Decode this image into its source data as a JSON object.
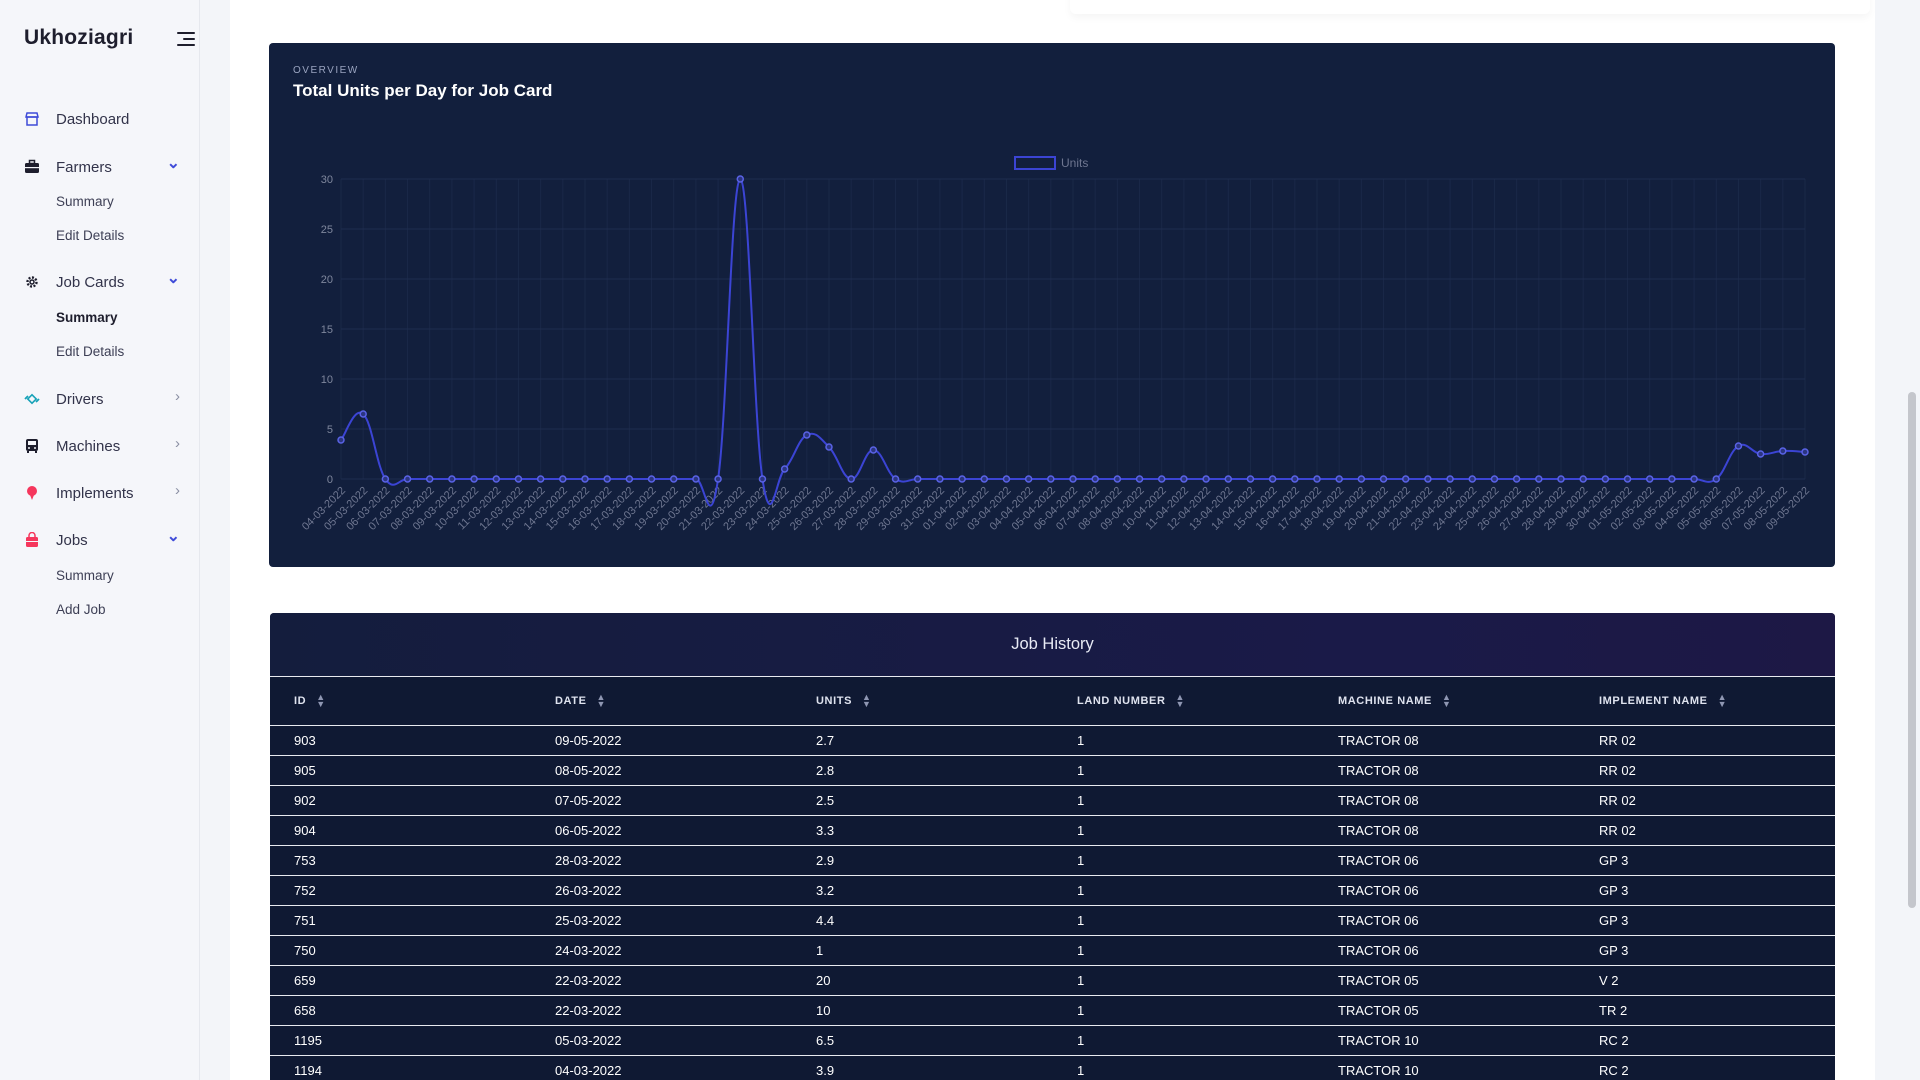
{
  "sidebar": {
    "brand": "Ukhoziagri",
    "items": [
      {
        "label": "Dashboard",
        "icon": "store-icon",
        "color": "#3f4bd8"
      },
      {
        "label": "Farmers",
        "icon": "briefcase-icon",
        "color": "#1e1e2d",
        "expanded": true,
        "children": [
          {
            "label": "Summary"
          },
          {
            "label": "Edit Details"
          }
        ]
      },
      {
        "label": "Job Cards",
        "icon": "gear-icon",
        "color": "#1e1e2d",
        "expanded": true,
        "children": [
          {
            "label": "Summary",
            "active": true
          },
          {
            "label": "Edit Details"
          }
        ]
      },
      {
        "label": "Drivers",
        "icon": "satellite-icon",
        "color": "#17a2b8"
      },
      {
        "label": "Machines",
        "icon": "bus-icon",
        "color": "#1e1e2d"
      },
      {
        "label": "Implements",
        "icon": "pin-icon",
        "color": "#f5365c"
      },
      {
        "label": "Jobs",
        "icon": "shopping-bag-icon",
        "color": "#f5365c",
        "expanded": true,
        "children": [
          {
            "label": "Summary"
          },
          {
            "label": "Add Job"
          }
        ]
      }
    ]
  },
  "chart_card": {
    "overline": "OVERVIEW",
    "title": "Total Units per Day for Job Card"
  },
  "chart_data": {
    "type": "line",
    "title": "Total Units per Day for Job Card",
    "legend": [
      "Units"
    ],
    "legend_position": "top-center",
    "ylim": [
      0,
      30
    ],
    "yticks": [
      0,
      5,
      10,
      15,
      20,
      25,
      30
    ],
    "grid": true,
    "line_color": "#3b44d4",
    "x": [
      "04-03-2022",
      "05-03-2022",
      "06-03-2022",
      "07-03-2022",
      "08-03-2022",
      "09-03-2022",
      "10-03-2022",
      "11-03-2022",
      "12-03-2022",
      "13-03-2022",
      "14-03-2022",
      "15-03-2022",
      "16-03-2022",
      "17-03-2022",
      "18-03-2022",
      "19-03-2022",
      "20-03-2022",
      "21-03-2022",
      "22-03-2022",
      "23-03-2022",
      "24-03-2022",
      "25-03-2022",
      "26-03-2022",
      "27-03-2022",
      "28-03-2022",
      "29-03-2022",
      "30-03-2022",
      "31-03-2022",
      "01-04-2022",
      "02-04-2022",
      "03-04-2022",
      "04-04-2022",
      "05-04-2022",
      "06-04-2022",
      "07-04-2022",
      "08-04-2022",
      "09-04-2022",
      "10-04-2022",
      "11-04-2022",
      "12-04-2022",
      "13-04-2022",
      "14-04-2022",
      "15-04-2022",
      "16-04-2022",
      "17-04-2022",
      "18-04-2022",
      "19-04-2022",
      "20-04-2022",
      "21-04-2022",
      "22-04-2022",
      "23-04-2022",
      "24-04-2022",
      "25-04-2022",
      "26-04-2022",
      "27-04-2022",
      "28-04-2022",
      "29-04-2022",
      "30-04-2022",
      "01-05-2022",
      "02-05-2022",
      "03-05-2022",
      "04-05-2022",
      "05-05-2022",
      "06-05-2022",
      "07-05-2022",
      "08-05-2022",
      "09-05-2022"
    ],
    "series": [
      {
        "name": "Units",
        "values": [
          3.9,
          6.5,
          0,
          0,
          0,
          0,
          0,
          0,
          0,
          0,
          0,
          0,
          0,
          0,
          0,
          0,
          0,
          0,
          30,
          0,
          1,
          4.4,
          3.2,
          0,
          2.9,
          0,
          0,
          0,
          0,
          0,
          0,
          0,
          0,
          0,
          0,
          0,
          0,
          0,
          0,
          0,
          0,
          0,
          0,
          0,
          0,
          0,
          0,
          0,
          0,
          0,
          0,
          0,
          0,
          0,
          0,
          0,
          0,
          0,
          0,
          0,
          0,
          0,
          0,
          3.3,
          2.5,
          2.8,
          2.7
        ]
      }
    ]
  },
  "table": {
    "title": "Job History",
    "columns": [
      "ID",
      "DATE",
      "UNITS",
      "LAND NUMBER",
      "MACHINE NAME",
      "IMPLEMENT NAME"
    ],
    "rows": [
      [
        "903",
        "09-05-2022",
        "2.7",
        "1",
        "TRACTOR 08",
        "RR 02"
      ],
      [
        "905",
        "08-05-2022",
        "2.8",
        "1",
        "TRACTOR 08",
        "RR 02"
      ],
      [
        "902",
        "07-05-2022",
        "2.5",
        "1",
        "TRACTOR 08",
        "RR 02"
      ],
      [
        "904",
        "06-05-2022",
        "3.3",
        "1",
        "TRACTOR 08",
        "RR 02"
      ],
      [
        "753",
        "28-03-2022",
        "2.9",
        "1",
        "TRACTOR 06",
        "GP 3"
      ],
      [
        "752",
        "26-03-2022",
        "3.2",
        "1",
        "TRACTOR 06",
        "GP 3"
      ],
      [
        "751",
        "25-03-2022",
        "4.4",
        "1",
        "TRACTOR 06",
        "GP 3"
      ],
      [
        "750",
        "24-03-2022",
        "1",
        "1",
        "TRACTOR 06",
        "GP 3"
      ],
      [
        "659",
        "22-03-2022",
        "20",
        "1",
        "TRACTOR 05",
        "V 2"
      ],
      [
        "658",
        "22-03-2022",
        "10",
        "1",
        "TRACTOR 05",
        "TR 2"
      ],
      [
        "1195",
        "05-03-2022",
        "6.5",
        "1",
        "TRACTOR 10",
        "RC 2"
      ],
      [
        "1194",
        "04-03-2022",
        "3.9",
        "1",
        "TRACTOR 10",
        "RC 2"
      ]
    ]
  }
}
